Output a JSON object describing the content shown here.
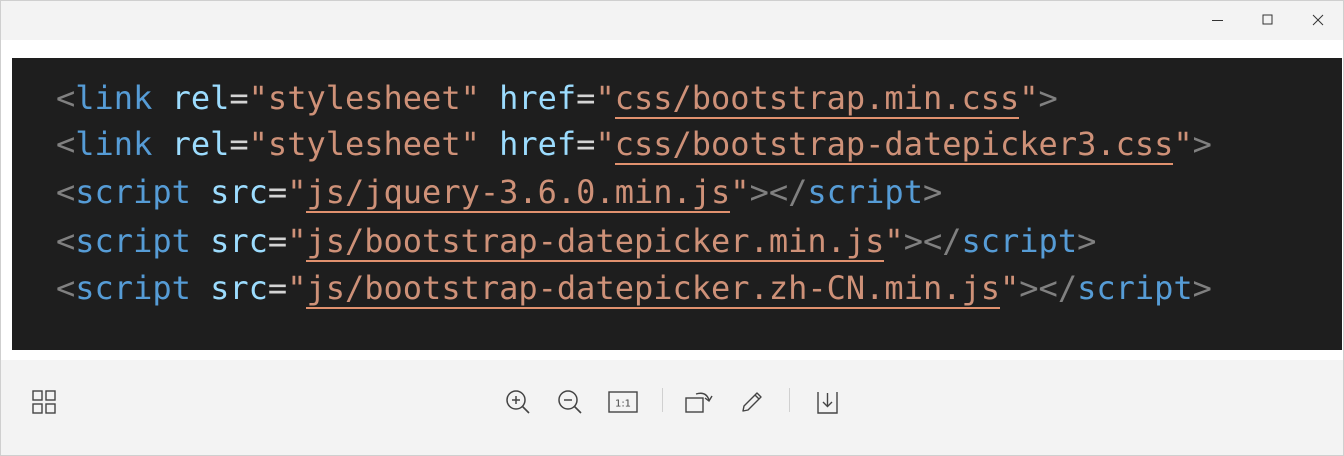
{
  "window": {
    "controls": [
      "minimize-icon",
      "maximize-icon",
      "close-icon"
    ]
  },
  "image": {
    "lines": [
      {
        "open": "<",
        "tag": "link",
        "attrs": [
          {
            "name": "rel",
            "eq": "=",
            "q1": "\"",
            "value": "stylesheet",
            "q2": "\"",
            "link": false
          },
          {
            "name": "href",
            "eq": "=",
            "q1": "\"",
            "value": "css/bootstrap.min.css",
            "q2": "\"",
            "link": true
          }
        ],
        "close": ">",
        "end": ""
      },
      {
        "open": "<",
        "tag": "link",
        "attrs": [
          {
            "name": "rel",
            "eq": "=",
            "q1": "\"",
            "value": "stylesheet",
            "q2": "\"",
            "link": false
          },
          {
            "name": "href",
            "eq": "=",
            "q1": "\"",
            "value": "css/bootstrap-datepicker3.css",
            "q2": "\"",
            "link": true
          }
        ],
        "close": ">",
        "end": ""
      },
      {
        "open": "<",
        "tag": "script",
        "attrs": [
          {
            "name": "src",
            "eq": "=",
            "q1": "\"",
            "value": "js/jquery-3.6.0.min.js",
            "q2": "\"",
            "link": true
          }
        ],
        "close": ">",
        "end": "script"
      },
      {
        "open": "<",
        "tag": "script",
        "attrs": [
          {
            "name": "src",
            "eq": "=",
            "q1": "\"",
            "value": "js/bootstrap-datepicker.min.js",
            "q2": "\"",
            "link": true
          }
        ],
        "close": ">",
        "end": "script"
      },
      {
        "open": "<",
        "tag": "script",
        "attrs": [
          {
            "name": "src",
            "eq": "=",
            "q1": "\"",
            "value": "js/bootstrap-datepicker.zh-CN.min.js",
            "q2": "\"",
            "link": true
          }
        ],
        "close": ">",
        "end": "script"
      }
    ],
    "colors": {
      "background": "#1e1e1e",
      "punctuation": "#808080",
      "tag": "#569cd6",
      "attribute": "#9cdcfe",
      "string": "#ce9178",
      "underline": "#e0916e"
    }
  },
  "toolbar": {
    "left": [
      "gallery-grid-icon"
    ],
    "center": [
      "zoom-in-icon",
      "zoom-out-icon",
      "actual-size-icon",
      "rotate-icon",
      "edit-pen-icon",
      "save-download-icon"
    ],
    "actual_size_label": "1:1"
  }
}
